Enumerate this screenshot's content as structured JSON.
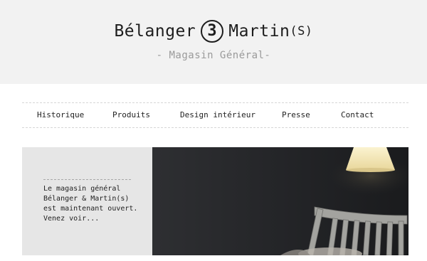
{
  "brand": {
    "name_left": "Bélanger",
    "badge": "3",
    "name_right": "Martin",
    "name_suffix": "(S)",
    "tagline": "- Magasin Général-"
  },
  "nav": {
    "items": [
      {
        "label": "Historique"
      },
      {
        "label": "Produits"
      },
      {
        "label": "Design intérieur"
      },
      {
        "label": "Presse"
      },
      {
        "label": "Contact"
      }
    ]
  },
  "intro": {
    "lines": [
      "Le magasin général",
      "Bélanger & Martin(s)",
      "est maintenant ouvert.",
      "Venez voir..."
    ]
  },
  "hero": {
    "description": "",
    "colors": {
      "wall": "#232427",
      "lamp_shade": "#f3e6b8",
      "chair": "#9b9b98"
    }
  },
  "colors": {
    "header_bg": "#f2f2f2",
    "intro_bg": "#e6e6e6",
    "text": "#222222",
    "tagline": "#9a9a9a"
  }
}
